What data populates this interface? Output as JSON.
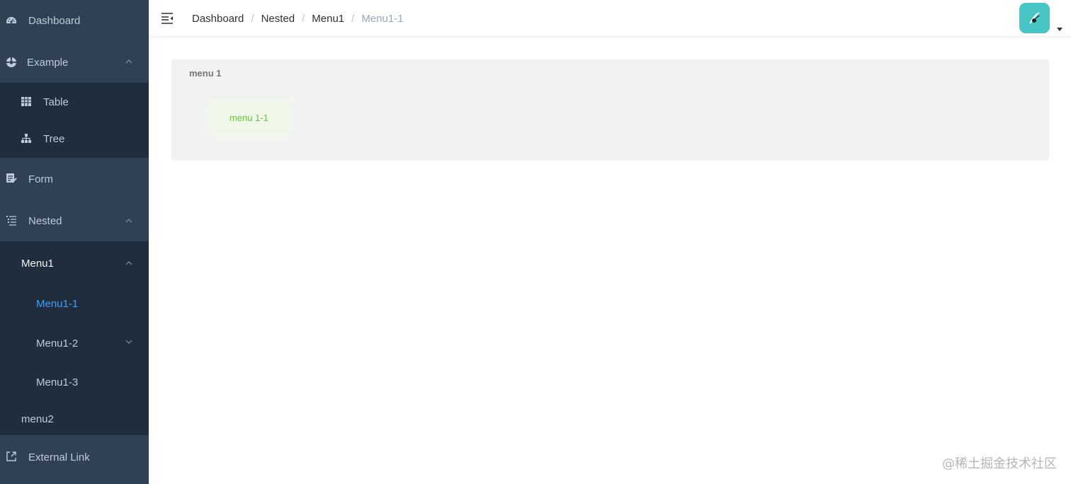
{
  "sidebar": {
    "items": [
      {
        "label": "Dashboard",
        "icon": "dashboard-icon"
      },
      {
        "label": "Example",
        "icon": "example-icon",
        "expanded": true,
        "children": [
          {
            "label": "Table",
            "icon": "table-icon"
          },
          {
            "label": "Tree",
            "icon": "tree-icon"
          }
        ]
      },
      {
        "label": "Form",
        "icon": "form-icon"
      },
      {
        "label": "Nested",
        "icon": "nested-icon",
        "expanded": true,
        "children": [
          {
            "label": "Menu1",
            "expanded": true,
            "children": [
              {
                "label": "Menu1-1",
                "active": true
              },
              {
                "label": "Menu1-2",
                "expanded": false
              },
              {
                "label": "Menu1-3"
              }
            ]
          },
          {
            "label": "menu2"
          }
        ]
      },
      {
        "label": "External Link",
        "icon": "external-link-icon"
      }
    ]
  },
  "navbar": {
    "breadcrumb": [
      "Dashboard",
      "Nested",
      "Menu1",
      "Menu1-1"
    ],
    "separator": "/"
  },
  "main": {
    "panel_title": "menu 1",
    "inner_label": "menu 1-1"
  },
  "watermark": "@稀土掘金技术社区",
  "colors": {
    "sidebar_bg": "#304156",
    "submenu_bg": "#1f2d3d",
    "sidebar_text": "#bfcbd9",
    "active": "#409eff",
    "avatar_bg": "#47c6c5",
    "inner_text": "#67c23a"
  }
}
